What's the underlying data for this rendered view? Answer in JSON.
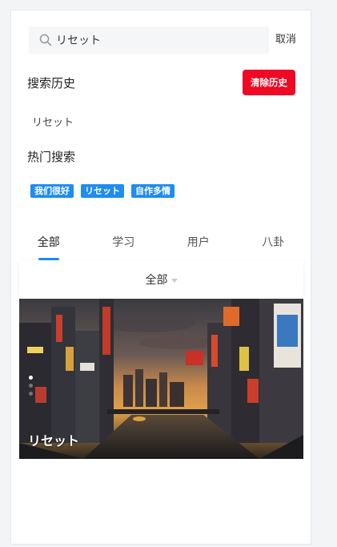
{
  "search": {
    "value": "リセット",
    "cancel_label": "取消"
  },
  "history": {
    "title": "搜索历史",
    "clear_label": "清除历史",
    "items": [
      "リセット"
    ]
  },
  "hot": {
    "title": "热门搜索",
    "tags": [
      "我们很好",
      "リセット",
      "自作多情"
    ]
  },
  "tabs": [
    {
      "label": "全部",
      "active": true
    },
    {
      "label": "学习",
      "active": false
    },
    {
      "label": "用户",
      "active": false
    },
    {
      "label": "八卦",
      "active": false
    }
  ],
  "filter": {
    "selected": "全部"
  },
  "banner": {
    "title": "リセット",
    "slide_count": 3,
    "active_slide": 1
  },
  "colors": {
    "accent": "#1e8cf0",
    "danger": "#ee0a24"
  }
}
